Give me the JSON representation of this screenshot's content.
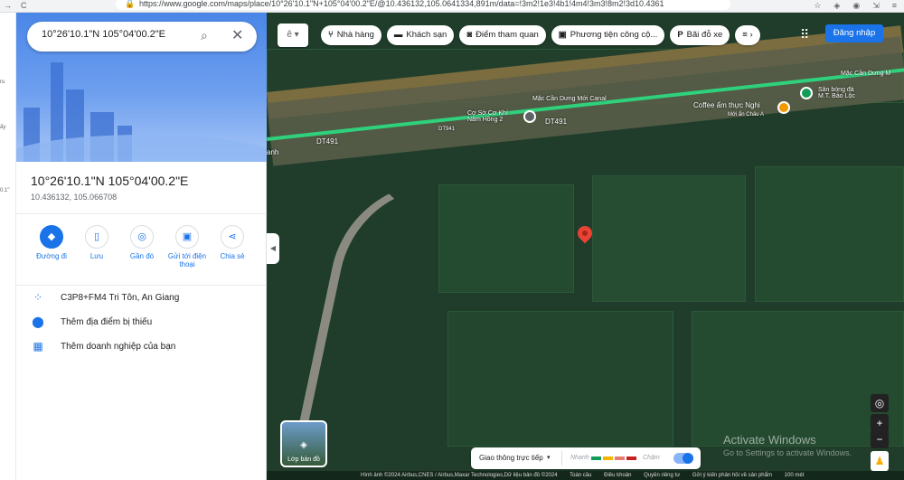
{
  "browser": {
    "url": "https://www.google.com/maps/place/10°26'10.1\"N+105°04'00.2\"E/@10.436132,105.0641334,891m/data=!3m2!1e3!4b1!4m4!3m3!8m2!3d10.4361",
    "nav_back": "→",
    "nav_reload": "C",
    "star": "☆"
  },
  "left_strip": {
    "texts": [
      "ru",
      "ấy",
      "0.1\""
    ]
  },
  "search": {
    "value": "10°26'10.1\"N 105°04'00.2\"E"
  },
  "place": {
    "title": "10°26'10.1\"N 105°04'00.2\"E",
    "coords": "10.436132, 105.066708"
  },
  "actions": [
    {
      "label": "Đường đi",
      "icon": "directions-icon",
      "glyph": "◆"
    },
    {
      "label": "Lưu",
      "icon": "bookmark-icon",
      "glyph": "▯"
    },
    {
      "label": "Gần đó",
      "icon": "nearby-icon",
      "glyph": "◎"
    },
    {
      "label": "Gửi tới điện thoại",
      "icon": "send-to-phone-icon",
      "glyph": "▣"
    },
    {
      "label": "Chia sẻ",
      "icon": "share-icon",
      "glyph": "⋖"
    }
  ],
  "info": [
    {
      "text": "C3P8+FM4 Tri Tôn, An Giang",
      "glyph": "⁘"
    },
    {
      "text": "Thêm địa điểm bị thiếu",
      "glyph": "⬤"
    },
    {
      "text": "Thêm doanh nghiệp của bạn",
      "glyph": "▦"
    }
  ],
  "chips": [
    {
      "label": "Nhà hàng",
      "glyph": "⑂"
    },
    {
      "label": "Khách sạn",
      "glyph": "▬"
    },
    {
      "label": "Điểm tham quan",
      "glyph": "◙"
    },
    {
      "label": "Phương tiện công cộ...",
      "glyph": "▣"
    },
    {
      "label": "Bãi đỗ xe",
      "glyph": "P"
    },
    {
      "label": "",
      "glyph": "≡ ›"
    }
  ],
  "login": "Đăng nhập",
  "map_labels": {
    "road1": "DT491",
    "road2": "DT941",
    "road3": "DT491",
    "canal": "Mặc Cần Dưng Mới Canal",
    "canal2": "Mặc Cần Dưng M",
    "poi1": "Cơ Sở Cơ Khí\nNăm Hồng 2",
    "poi2": "Coffee ẩm thực Nghi",
    "poi2b": "Mới ẩn Châu A",
    "poi3": "Sân bóng đá\nM.T. Bảo Lộc",
    "ranh": "anh"
  },
  "layers_label": "Lớp bản đồ",
  "traffic": {
    "label": "Giao thông trực tiếp",
    "fast": "Nhanh",
    "slow": "Chậm",
    "colors": [
      "#0f9d58",
      "#f4b400",
      "#e67c73",
      "#c5221f"
    ]
  },
  "watermark": {
    "title": "Activate Windows",
    "sub": "Go to Settings to activate Windows."
  },
  "footer": [
    "Hình ảnh ©2024 Airbus,CNES / Airbus,Maxar Technologies,Dữ liệu bản đồ ©2024",
    "Toàn cầu",
    "Điều khoản",
    "Quyền riêng tư",
    "Gửi ý kiến phản hồi về sản phẩm",
    "100 mét"
  ]
}
